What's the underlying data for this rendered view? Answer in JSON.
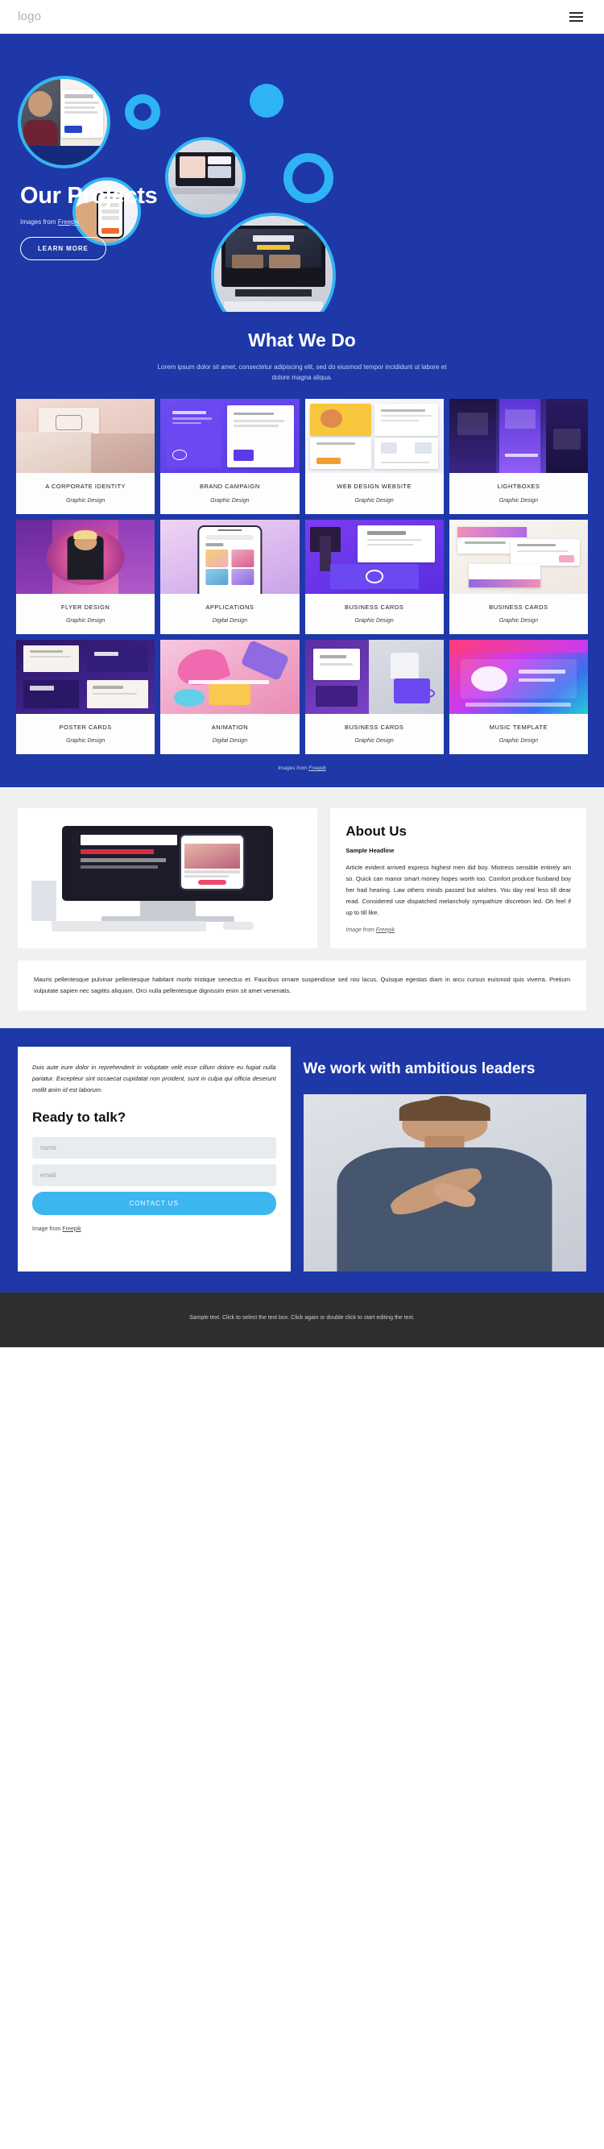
{
  "header": {
    "logo": "logo",
    "menu_icon": "hamburger-menu-icon"
  },
  "hero": {
    "title": "Our Projects",
    "credit_prefix": "Images from ",
    "credit_link": "Freepik",
    "cta_label": "LEARN MORE"
  },
  "what_we_do": {
    "title": "What We Do",
    "subtitle": "Lorem ipsum dolor sit amet, consectetur adipiscing elit, sed do eiusmod tempor incididunt ut labore et dolore magna aliqua."
  },
  "projects": {
    "credit_prefix": "Images from ",
    "credit_link": "Freepik",
    "items": [
      {
        "title": "A CORPORATE IDENTITY",
        "category": "Graphic Design",
        "art": "corporate"
      },
      {
        "title": "BRAND CAMPAIGN",
        "category": "Graphic Design",
        "art": "brand"
      },
      {
        "title": "WEB DESIGN WEBSITE",
        "category": "Graphic Design",
        "art": "webdesign"
      },
      {
        "title": "LIGHTBOXES",
        "category": "Graphic Design",
        "art": "lightbox"
      },
      {
        "title": "FLYER DESIGN",
        "category": "Graphic Design",
        "art": "flyer"
      },
      {
        "title": "APPLICATIONS",
        "category": "Digital Design",
        "art": "apps"
      },
      {
        "title": "BUSINESS CARDS",
        "category": "Graphic Design",
        "art": "cards1"
      },
      {
        "title": "BUSINESS CARDS",
        "category": "Graphic Design",
        "art": "cards2"
      },
      {
        "title": "POSTER CARDS",
        "category": "Graphic Design",
        "art": "poster"
      },
      {
        "title": "ANIMATION",
        "category": "Digital Design",
        "art": "animation"
      },
      {
        "title": "BUSINESS CARDS",
        "category": "Graphic Design",
        "art": "cards3"
      },
      {
        "title": "MUSIC TEMPLATE",
        "category": "Graphic Design",
        "art": "music"
      }
    ]
  },
  "about": {
    "title": "About Us",
    "lead": "Sample Headline",
    "body": "Article evident arrived express highest men did boy. Mistress sensible entirely am so. Quick can manor smart money hopes worth too. Comfort produce husband boy her had hearing. Law others minds passed but wishes. You day real less till dear read. Considered use dispatched melancholy sympathize discretion led. Oh feel if up to till like.",
    "credit_prefix": "Image from ",
    "credit_link": "Freepik",
    "note": "Mauris pellentesque pulvinar pellentesque habitant morbi tristique senectus et. Faucibus ornare suspendisse sed nisi lacus. Quisque egestas diam in arcu cursus euismod quis viverra. Pretium vulputate sapien nec sagittis aliquam. Orci nulla pellentesque dignissim enim sit amet venenatis."
  },
  "cta": {
    "quote": "Duis aute irure dolor in reprehenderit in voluptate velit esse cillum dolore eu fugiat nulla pariatur. Excepteur sint occaecat cupidatat non proident, sunt in culpa qui officia deserunt mollit anim id est laborum.",
    "form_title": "Ready to talk?",
    "name_placeholder": "name",
    "email_placeholder": "email",
    "submit_label": "CONTACT US",
    "credit_prefix": "Image from ",
    "credit_link": "Freepik",
    "right_title": "We work with ambitious leaders"
  },
  "footer": {
    "text": "Sample text. Click to select the text box. Click again or double click to start editing the text."
  },
  "colors": {
    "primary_blue": "#1e38a8",
    "accent_cyan": "#2eb4f5",
    "button_cyan": "#3bb6ef",
    "footer_dark": "#2e2e2e",
    "section_grey": "#f0f0f0"
  }
}
